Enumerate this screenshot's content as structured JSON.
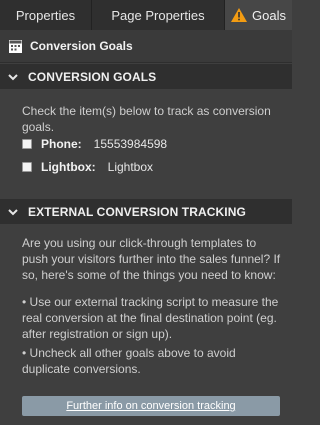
{
  "tabs": [
    {
      "label": "Properties"
    },
    {
      "label": "Page Properties"
    },
    {
      "label": "Goals"
    }
  ],
  "toolbar": {
    "title": "Conversion Goals"
  },
  "sections": {
    "conversion_goals": {
      "header": "CONVERSION GOALS",
      "intro": "Check the item(s) below to track as conversion goals.",
      "items": [
        {
          "key": "Phone:",
          "value": "15553984598"
        },
        {
          "key": "Lightbox:",
          "value": "Lightbox"
        }
      ]
    },
    "external": {
      "header": "EXTERNAL CONVERSION TRACKING",
      "intro": "Are you using our click-through templates to push your visitors further into the sales funnel? If so, here's some of the things you need to know:",
      "bullets": [
        "•  Use our external tracking script to measure the real conversion at the final destination point (eg. after registration or sign up).",
        "•  Uncheck all other goals above to avoid duplicate conversions."
      ],
      "button_label": "Further info on conversion tracking"
    }
  }
}
